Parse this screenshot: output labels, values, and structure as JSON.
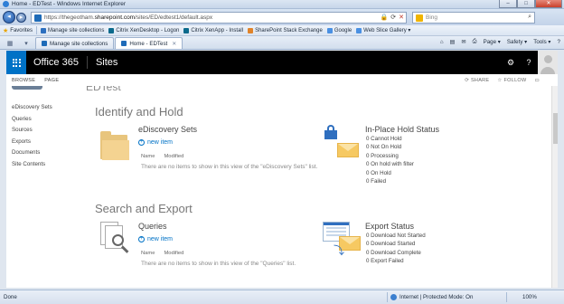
{
  "browser": {
    "window_title": "Home - EDTest - Windows Internet Explorer",
    "url_prefix": "https://thegeotham.",
    "url_host": "sharepoint.com",
    "url_rest": "/sites/ED/edtest1/default.aspx",
    "search_placeholder": "Bing",
    "favorites_label": "Favorites",
    "favorites": [
      "Manage site collections",
      "Citrix XenDesktop - Logon",
      "Citrix XenApp - Install",
      "SharePoint Stack Exchange",
      "Google",
      "Web Slice Gallery ▾"
    ],
    "tabs": [
      "Manage site collections",
      "Home - EDTest"
    ],
    "commands": [
      "Page ▾",
      "Safety ▾",
      "Tools ▾",
      "?"
    ],
    "status_left": "Done",
    "status_zone": "Internet | Protected Mode: On",
    "zoom": "100%"
  },
  "suitebar": {
    "brand": "Office 365",
    "app": "Sites"
  },
  "ribbon": {
    "tabs": [
      "BROWSE",
      "PAGE"
    ],
    "share": "SHARE",
    "follow": "FOLLOW"
  },
  "page": {
    "cut_title": "EDTest"
  },
  "leftnav": [
    "eDiscovery Sets",
    "Queries",
    "Sources",
    "Exports",
    "Documents",
    "Site Contents"
  ],
  "identify": {
    "heading": "Identify and Hold",
    "sets_title": "eDiscovery Sets",
    "new_item": "new item",
    "col_name": "Name",
    "col_modified": "Modified",
    "empty_text": "There are no items to show in this view of the \"eDiscovery Sets\" list.",
    "hold_title": "In-Place Hold Status",
    "hold_status": [
      "0 Cannot Hold",
      "0 Not On Hold",
      "0 Processing",
      "0 On hold with filter",
      "0 On Hold",
      "0 Failed"
    ]
  },
  "search": {
    "heading": "Search and Export",
    "queries_title": "Queries",
    "new_item": "new item",
    "col_name": "Name",
    "col_modified": "Modified",
    "empty_text": "There are no items to show in this view of the \"Queries\" list.",
    "export_title": "Export Status",
    "export_status": [
      "0 Download Not Started",
      "0 Download Started",
      "0 Download Complete",
      "0 Export Failed"
    ]
  }
}
